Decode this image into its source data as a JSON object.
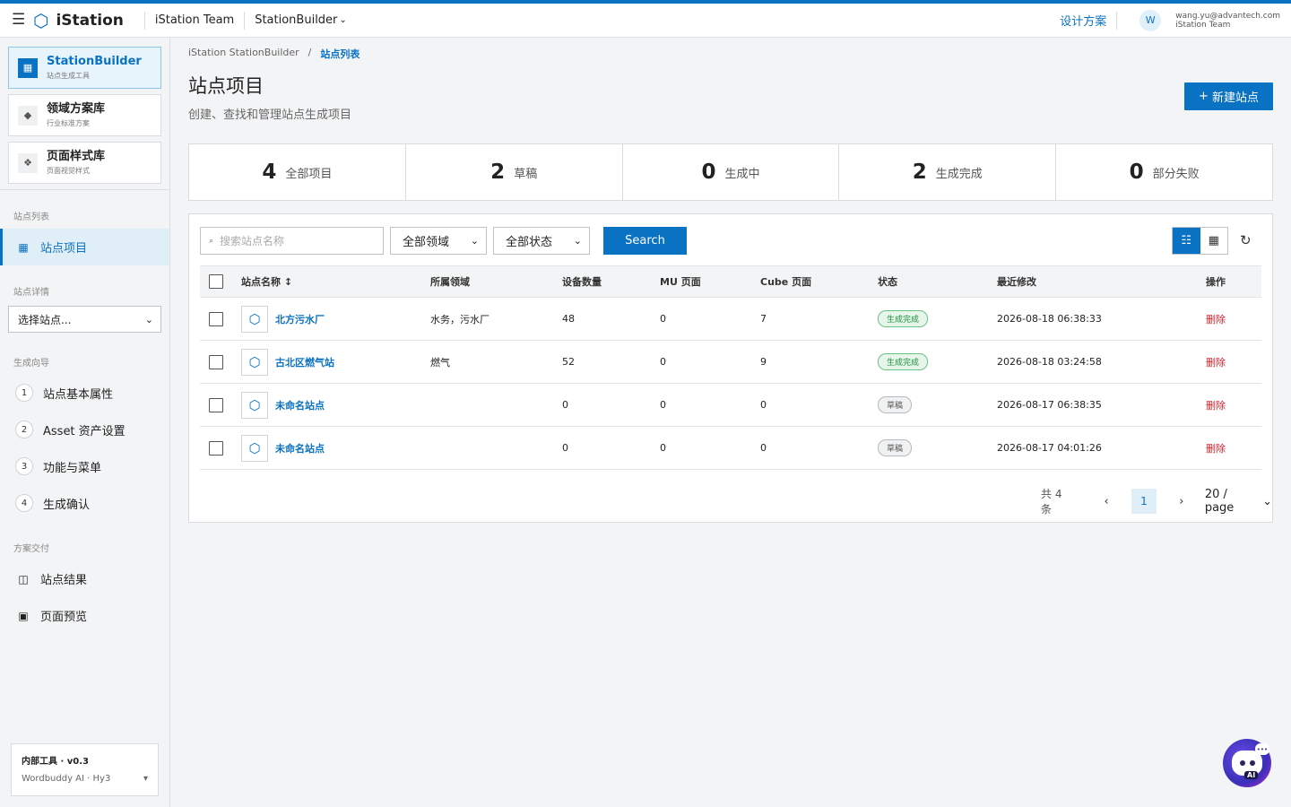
{
  "topbar": {
    "brand": "iStation",
    "team": "iStation Team",
    "product": "StationBuilder",
    "design_link": "设计方案",
    "avatar_initial": "W",
    "user_email": "wang.yu@advantech.com",
    "user_team": "iStation Team"
  },
  "sidebar": {
    "products": [
      {
        "title": "StationBuilder",
        "sub": "站点生成工具",
        "icon": "grid-icon",
        "active": true
      },
      {
        "title": "领域方案库",
        "sub": "行业标准方案",
        "icon": "diamond-icon",
        "active": false
      },
      {
        "title": "页面样式库",
        "sub": "页面视觉样式",
        "icon": "style-icon",
        "active": false
      }
    ],
    "section_site_list": "站点列表",
    "nav_site_projects": "站点项目",
    "section_site_detail": "站点详情",
    "site_select_placeholder": "选择站点...",
    "section_wizard": "生成向导",
    "steps": [
      {
        "num": "1",
        "label": "站点基本属性"
      },
      {
        "num": "2",
        "label": "Asset 资产设置"
      },
      {
        "num": "3",
        "label": "功能与菜单"
      },
      {
        "num": "4",
        "label": "生成确认"
      }
    ],
    "section_delivery": "方案交付",
    "nav_site_results": "站点结果",
    "nav_page_preview": "页面预览",
    "footer_title": "内部工具 · v0.3",
    "footer_sub": "Wordbuddy AI · Hy3"
  },
  "breadcrumb": {
    "root": "iStation StationBuilder",
    "separator": "/",
    "current": "站点列表"
  },
  "page": {
    "title": "站点项目",
    "subtitle": "创建、查找和管理站点生成项目",
    "new_button": "新建站点",
    "new_button_icon": "+"
  },
  "stats": [
    {
      "num": "4",
      "label": "全部项目"
    },
    {
      "num": "2",
      "label": "草稿"
    },
    {
      "num": "0",
      "label": "生成中"
    },
    {
      "num": "2",
      "label": "生成完成"
    },
    {
      "num": "0",
      "label": "部分失败"
    }
  ],
  "filters": {
    "search_placeholder": "搜索站点名称",
    "domain_value": "全部领域",
    "status_value": "全部状态",
    "search_button": "Search"
  },
  "table": {
    "headers": {
      "name": "站点名称 ↕",
      "domain": "所属领域",
      "devices": "设备数量",
      "mu": "MU 页面",
      "cube": "Cube 页面",
      "status": "状态",
      "modified": "最近修改",
      "actions": "操作"
    },
    "rows": [
      {
        "name": "北方污水厂",
        "domain": "水务，污水厂",
        "devices": "48",
        "mu": "0",
        "cube": "7",
        "status": "生成完成",
        "status_type": "ok",
        "modified": "2026-08-18 06:38:33",
        "action": "删除"
      },
      {
        "name": "古北区燃气站",
        "domain": "燃气",
        "devices": "52",
        "mu": "0",
        "cube": "9",
        "status": "生成完成",
        "status_type": "ok",
        "modified": "2026-08-18 03:24:58",
        "action": "删除"
      },
      {
        "name": "未命名站点",
        "domain": "",
        "devices": "0",
        "mu": "0",
        "cube": "0",
        "status": "草稿",
        "status_type": "draft",
        "modified": "2026-08-17 06:38:35",
        "action": "删除"
      },
      {
        "name": "未命名站点",
        "domain": "",
        "devices": "0",
        "mu": "0",
        "cube": "0",
        "status": "草稿",
        "status_type": "draft",
        "modified": "2026-08-17 04:01:26",
        "action": "删除"
      }
    ]
  },
  "pagination": {
    "total": "共 4 条",
    "current_page": "1",
    "page_size": "20 / page"
  },
  "ai_assistant": {
    "label": "AI"
  },
  "colors": {
    "accent": "#0a72c2",
    "success": "#1e8e3e",
    "danger": "#da1e28"
  }
}
